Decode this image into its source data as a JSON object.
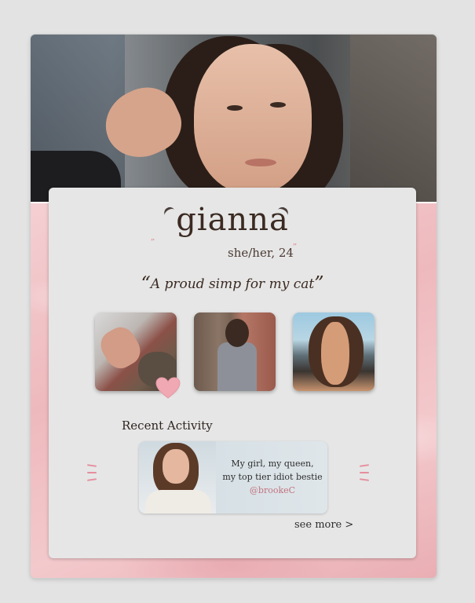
{
  "profile": {
    "name": "gianna",
    "pronouns_age": "she/her, 24",
    "quote": "A proud simp for my cat",
    "quote_open": "“",
    "quote_close": "”"
  },
  "decor": {
    "blush_left": "‚‚",
    "blush_right": "‚‚"
  },
  "gallery": {
    "photos": [
      {
        "icon": "photo-cat-paw-high-five"
      },
      {
        "icon": "photo-brick-wall-portrait"
      },
      {
        "icon": "photo-beach-sunglasses"
      }
    ],
    "liked_icon": "heart-icon"
  },
  "recent_activity": {
    "title": "Recent Activity",
    "post": {
      "line1": "My girl, my queen,",
      "line2": "my top tier idiot bestie",
      "handle": "@brookeC"
    },
    "see_more": "see more >"
  },
  "colors": {
    "background": "#e3e3e3",
    "panel": "#e6e6e6",
    "marble_pink": "#f2c7cb",
    "heart": "#f0a8b2",
    "handle": "#c2727e",
    "accent_dash": "#e68e9d"
  }
}
